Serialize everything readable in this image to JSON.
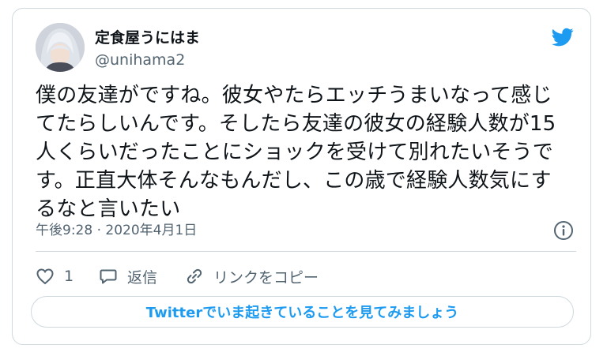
{
  "user": {
    "display_name": "定食屋うにはま",
    "handle": "@unihama2"
  },
  "tweet": {
    "text": "僕の友達がですね。彼女やたらエッチうまいなって感じ\nてたらしいんです。そしたら友達の彼女の経験人数が15\n人くらいだったことにショックを受けて別れたいそうで\nす。正直大体そんなもんだし、この歳で経験人数気にす\nるなと言いたい",
    "timestamp": "午後9:28 · 2020年4月1日"
  },
  "actions": {
    "like_count": "1",
    "reply_label": "返信",
    "copy_link_label": "リンクをコピー"
  },
  "cta": {
    "label": "Twitterでいま起きていることを見てみましょう"
  },
  "icons": {
    "brand": "twitter-bird-icon",
    "info": "info-icon",
    "like": "heart-icon",
    "reply": "speech-bubble-icon",
    "link": "link-icon"
  },
  "colors": {
    "accent": "#1d9bf0",
    "secondary_text": "#536471",
    "border": "#cfd9de"
  }
}
